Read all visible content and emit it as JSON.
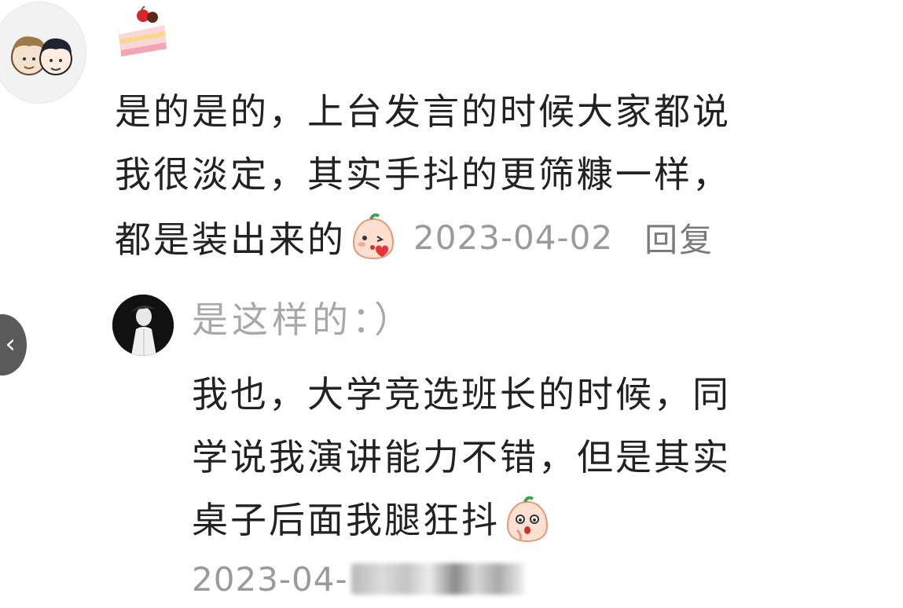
{
  "back_button": {
    "icon": "chevron-left-icon",
    "glyph": "‹"
  },
  "comment": {
    "avatar": "user-avatar",
    "badge": "cake-badge-icon",
    "lines": [
      "是的是的，上台发言的时候大家都说",
      "我很淡定，其实手抖的更筛糠一样，",
      "都是装出来的"
    ],
    "emoji": "blush-kiss-emoji",
    "timestamp": "2023-04-02",
    "reply_label": "回复"
  },
  "reply": {
    "avatar": "reply-user-avatar",
    "username": "是这样的：）",
    "lines": [
      "我也，大学竞选班长的时候，同",
      "学说我演讲能力不错，但是其实",
      "桌子后面我腿狂抖"
    ],
    "emoji": "shy-giggle-emoji",
    "timestamp": "2023-04-"
  }
}
